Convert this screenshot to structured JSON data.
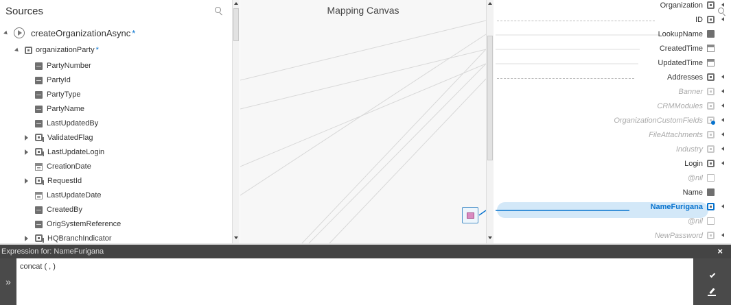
{
  "sources": {
    "title": "Sources",
    "root": {
      "label": "createOrganizationAsync",
      "required_mark": "*"
    },
    "party": {
      "label": "organizationParty",
      "required_mark": "*"
    },
    "items": [
      {
        "label": "PartyNumber",
        "icon": "field-icon",
        "expandable": false
      },
      {
        "label": "PartyId",
        "icon": "field-icon",
        "expandable": false
      },
      {
        "label": "PartyType",
        "icon": "field-icon",
        "expandable": false
      },
      {
        "label": "PartyName",
        "icon": "field-icon",
        "expandable": false
      },
      {
        "label": "LastUpdatedBy",
        "icon": "field-icon",
        "expandable": false
      },
      {
        "label": "ValidatedFlag",
        "icon": "object-list-icon",
        "expandable": true
      },
      {
        "label": "LastUpdateLogin",
        "icon": "object-list-icon",
        "expandable": true
      },
      {
        "label": "CreationDate",
        "icon": "date-icon",
        "expandable": false
      },
      {
        "label": "RequestId",
        "icon": "object-list-icon",
        "expandable": true
      },
      {
        "label": "LastUpdateDate",
        "icon": "date-icon",
        "expandable": false
      },
      {
        "label": "CreatedBy",
        "icon": "field-icon",
        "expandable": false
      },
      {
        "label": "OrigSystemReference",
        "icon": "field-icon",
        "expandable": false
      },
      {
        "label": "HQBranchIndicator",
        "icon": "object-list-icon",
        "expandable": true
      }
    ]
  },
  "canvas": {
    "title": "Mapping Canvas"
  },
  "targets": {
    "items": [
      {
        "label": "Organization",
        "icon": "object-icon",
        "muted": false
      },
      {
        "label": "ID",
        "icon": "object-icon",
        "muted": false
      },
      {
        "label": "LookupName",
        "icon": "field-icon",
        "muted": false
      },
      {
        "label": "CreatedTime",
        "icon": "date-icon",
        "muted": false
      },
      {
        "label": "UpdatedTime",
        "icon": "date-icon",
        "muted": false
      },
      {
        "label": "Addresses",
        "icon": "object-icon",
        "muted": false
      },
      {
        "label": "Banner",
        "icon": "object-icon",
        "muted": true
      },
      {
        "label": "CRMModules",
        "icon": "object-icon",
        "muted": true
      },
      {
        "label": "OrganizationCustomFields",
        "icon": "object-icon",
        "muted": true
      },
      {
        "label": "FileAttachments",
        "icon": "object-icon",
        "muted": true
      },
      {
        "label": "Industry",
        "icon": "object-list-icon",
        "muted": true
      },
      {
        "label": "Login",
        "icon": "object-list-icon",
        "muted": false
      },
      {
        "label": "@nil",
        "icon": "nil-icon",
        "muted": true
      },
      {
        "label": "Name",
        "icon": "field-icon",
        "muted": false
      },
      {
        "label": "NameFurigana",
        "icon": "object-list-icon",
        "muted": false,
        "selected": true
      },
      {
        "label": "@nil",
        "icon": "nil-icon",
        "muted": true
      },
      {
        "label": "NewPassword",
        "icon": "object-icon",
        "muted": true
      }
    ]
  },
  "expression": {
    "header": "Expression for: NameFurigana",
    "value": "concat ( , )",
    "toggle_glyph": "»",
    "close_glyph": "×"
  },
  "colors": {
    "accent": "#0572ce",
    "selection": "#d3e8f8",
    "panel_dark": "#444444"
  }
}
